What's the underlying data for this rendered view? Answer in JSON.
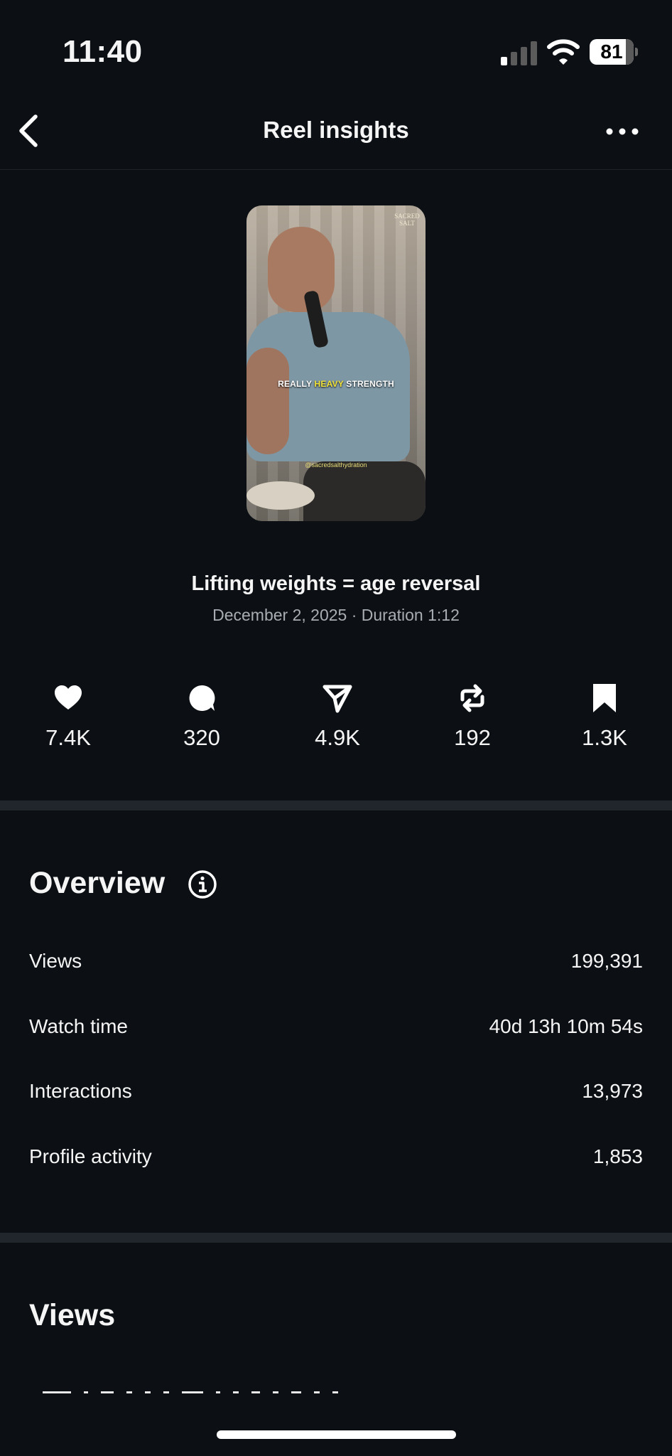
{
  "status_bar": {
    "time": "11:40",
    "battery": "81"
  },
  "nav": {
    "title": "Reel insights",
    "back_icon": "chevron-left-icon",
    "more_icon": "more-horizontal-icon"
  },
  "reel": {
    "thumbnail": {
      "caption_pre": "REALLY ",
      "caption_highlight": "HEAVY",
      "caption_post": " STRENGTH",
      "handle": "@sacredsalthydration",
      "brand_line1": "SACRED",
      "brand_line2": "SALT"
    },
    "title": "Lifting weights = age reversal",
    "meta": "December 2, 2025 · Duration 1:12"
  },
  "stats": [
    {
      "icon": "heart-icon",
      "value": "7.4K"
    },
    {
      "icon": "comment-icon",
      "value": "320"
    },
    {
      "icon": "share-icon",
      "value": "4.9K"
    },
    {
      "icon": "repost-icon",
      "value": "192"
    },
    {
      "icon": "bookmark-icon",
      "value": "1.3K"
    }
  ],
  "overview": {
    "title": "Overview",
    "info_icon": "info-icon",
    "rows": [
      {
        "label": "Views",
        "value": "199,391"
      },
      {
        "label": "Watch time",
        "value": "40d 13h 10m 54s"
      },
      {
        "label": "Interactions",
        "value": "13,973"
      },
      {
        "label": "Profile activity",
        "value": "1,853"
      }
    ]
  },
  "views_section": {
    "title": "Views"
  },
  "colors": {
    "background": "#0c1014",
    "divider": "#21262c",
    "secondary_text": "#a8adb3",
    "caption_highlight": "#f2e33a"
  }
}
